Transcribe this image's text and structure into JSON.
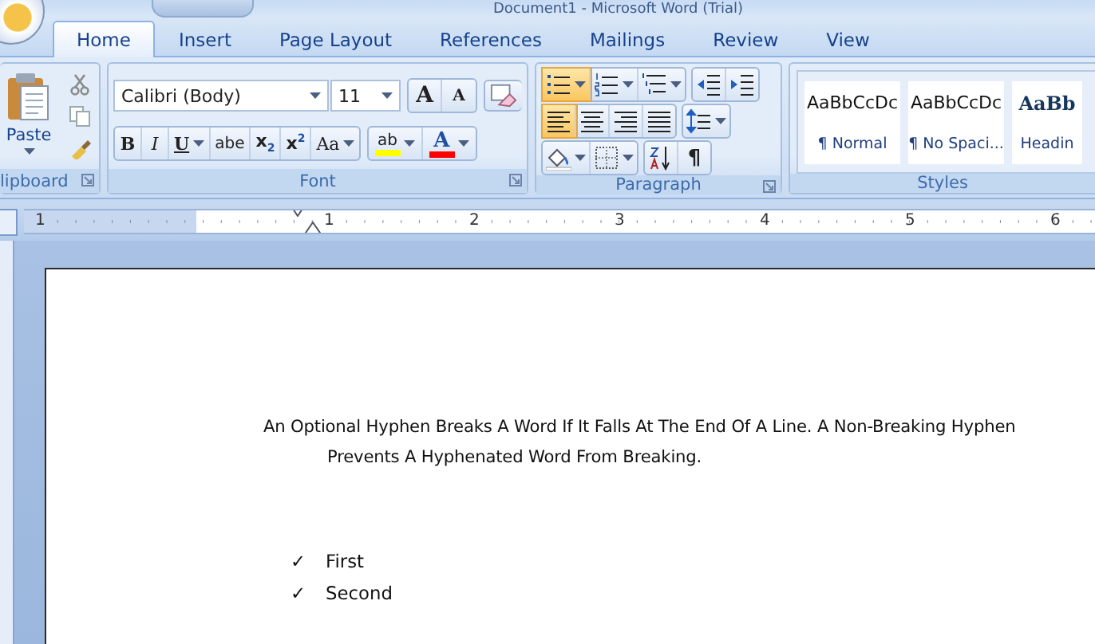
{
  "window": {
    "title": "Document1 - Microsoft Word (Trial)"
  },
  "tabs": [
    {
      "label": "Home",
      "selected": true
    },
    {
      "label": "Insert",
      "selected": false
    },
    {
      "label": "Page Layout",
      "selected": false
    },
    {
      "label": "References",
      "selected": false
    },
    {
      "label": "Mailings",
      "selected": false
    },
    {
      "label": "Review",
      "selected": false
    },
    {
      "label": "View",
      "selected": false
    }
  ],
  "clipboard": {
    "label": "lipboard",
    "paste_label": "Paste"
  },
  "font": {
    "label": "Font",
    "font_name": "Calibri (Body)",
    "font_size": "11",
    "grow_label": "A",
    "shrink_label": "A",
    "buttons": [
      {
        "kind": "bold",
        "label": "B",
        "dropdown": false
      },
      {
        "kind": "italic",
        "label": "I",
        "dropdown": false
      },
      {
        "kind": "underline",
        "label": "U",
        "dropdown": true
      },
      {
        "kind": "strike",
        "label": "abe",
        "dropdown": false
      },
      {
        "kind": "sub",
        "label": "x$_{2}$",
        "dropdown": false
      },
      {
        "kind": "sup",
        "label": "x$^{2}$",
        "dropdown": false
      },
      {
        "kind": "case",
        "label": "Aa",
        "dropdown": true
      }
    ],
    "colors": [
      {
        "kind": "highlight",
        "label": "ab",
        "color": "#ffff00"
      },
      {
        "kind": "fontcolor",
        "label": "A",
        "color": "#ff0000"
      }
    ]
  },
  "paragraph": {
    "label": "Paragraph",
    "rows": [
      {
        "buttons": [
          {
            "kind": "bullets",
            "selected": true,
            "dropdown": true
          },
          {
            "kind": "numbering",
            "selected": false,
            "dropdown": true
          },
          {
            "kind": "multilevel",
            "selected": false,
            "dropdown": true
          },
          {
            "kind": "outdent",
            "selected": false,
            "dropdown": false
          },
          {
            "kind": "indent",
            "selected": false,
            "dropdown": false
          }
        ]
      },
      {
        "buttons": [
          {
            "kind": "align-left",
            "selected": true,
            "dropdown": false
          },
          {
            "kind": "align-center",
            "selected": false,
            "dropdown": false
          },
          {
            "kind": "align-right",
            "selected": false,
            "dropdown": false
          },
          {
            "kind": "justify",
            "selected": false,
            "dropdown": false
          },
          {
            "kind": "line-spacing",
            "selected": false,
            "dropdown": true
          }
        ]
      },
      {
        "buttons": [
          {
            "kind": "shading",
            "selected": false,
            "dropdown": true
          },
          {
            "kind": "borders",
            "selected": false,
            "dropdown": true
          },
          {
            "kind": "sort",
            "selected": false,
            "dropdown": false
          },
          {
            "kind": "pilcrow",
            "label": "¶",
            "selected": false,
            "dropdown": false
          }
        ]
      }
    ]
  },
  "styles": {
    "label": "Styles",
    "items": [
      {
        "kind": "body",
        "preview": "AaBbCcDc",
        "name": "¶ Normal"
      },
      {
        "kind": "body",
        "preview": "AaBbCcDc",
        "name": "¶ No Spaci..."
      },
      {
        "kind": "heading",
        "preview": "AaBb",
        "name": "Headin"
      }
    ]
  },
  "ruler": {
    "labels": [
      "1",
      "1",
      "2",
      "3",
      "4",
      "5",
      "6"
    ]
  },
  "document": {
    "paragraph": "An Optional Hyphen Breaks A Word If It Falls At The End Of A Line. A Non-Breaking Hyphen Prevents A Hyphenated Word From Breaking.",
    "list": [
      {
        "bullet": "✓",
        "text": "First"
      },
      {
        "bullet": "✓",
        "text": "Second"
      }
    ]
  }
}
